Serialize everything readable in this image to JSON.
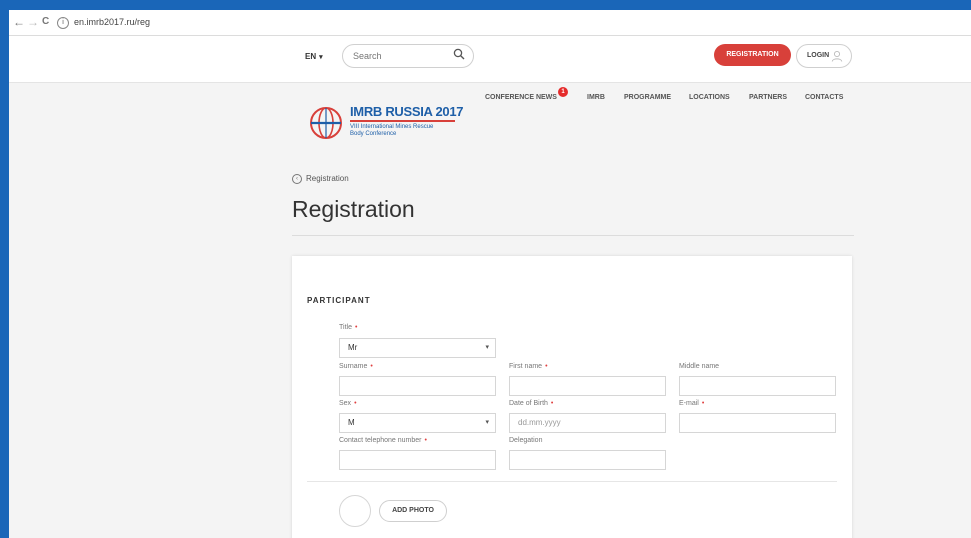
{
  "browser": {
    "url": "en.imrb2017.ru/reg",
    "back": "←",
    "forward": "→",
    "reload": "C",
    "info": "i"
  },
  "header": {
    "lang": "EN",
    "search_placeholder": "Search",
    "registration_label": "REGISTRATION",
    "login_label": "LOGIN"
  },
  "logo": {
    "name": "IMRB RUSSIA 2017",
    "sub1": "VIII International Mines Rescue",
    "sub2": "Body Conference"
  },
  "nav": {
    "items": [
      "CONFERENCE NEWS",
      "IMRB",
      "PROGRAMME",
      "LOCATIONS",
      "PARTNERS",
      "CONTACTS"
    ],
    "badge": "1"
  },
  "breadcrumb": "Registration",
  "page_title": "Registration",
  "form": {
    "section": "PARTICIPANT",
    "title_label": "Title",
    "title_value": "Mr",
    "surname_label": "Surname",
    "first_name_label": "First name",
    "middle_name_label": "Middle name",
    "sex_label": "Sex",
    "sex_value": "M",
    "dob_label": "Date of Birth",
    "dob_placeholder": "dd.mm.yyyy",
    "email_label": "E-mail",
    "phone_label": "Contact telephone number",
    "delegation_label": "Delegation",
    "required_mark": "•",
    "add_photo": "ADD PHOTO"
  },
  "colors": {
    "accent_red": "#d8403a",
    "brand_blue": "#1e5fa8",
    "frame_blue": "#1a66b8"
  }
}
